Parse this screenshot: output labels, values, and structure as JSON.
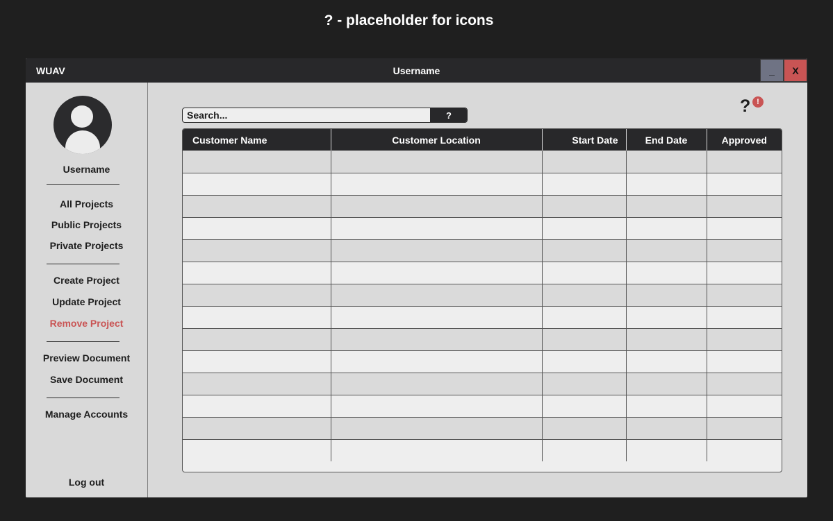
{
  "note": "? - placeholder for icons",
  "window": {
    "app_name": "WUAV",
    "title": "Username",
    "minimize_label": "_",
    "close_label": "X"
  },
  "sidebar": {
    "username": "Username",
    "nav": {
      "all_projects": "All Projects",
      "public_projects": "Public Projects",
      "private_projects": "Private Projects",
      "create_project": "Create Project",
      "update_project": "Update Project",
      "remove_project": "Remove Project",
      "preview_document": "Preview Document",
      "save_document": "Save Document",
      "manage_accounts": "Manage Accounts",
      "log_out": "Log out"
    }
  },
  "search": {
    "placeholder": "Search...",
    "button_label": "?"
  },
  "notifications": {
    "help_icon_label": "?",
    "alert_badge_label": "!"
  },
  "table": {
    "columns": [
      "Customer Name",
      "Customer Location",
      "Start Date",
      "End Date",
      "Approved"
    ],
    "rows": [
      [
        "",
        "",
        "",
        "",
        ""
      ],
      [
        "",
        "",
        "",
        "",
        ""
      ],
      [
        "",
        "",
        "",
        "",
        ""
      ],
      [
        "",
        "",
        "",
        "",
        ""
      ],
      [
        "",
        "",
        "",
        "",
        ""
      ],
      [
        "",
        "",
        "",
        "",
        ""
      ],
      [
        "",
        "",
        "",
        "",
        ""
      ],
      [
        "",
        "",
        "",
        "",
        ""
      ],
      [
        "",
        "",
        "",
        "",
        ""
      ],
      [
        "",
        "",
        "",
        "",
        ""
      ],
      [
        "",
        "",
        "",
        "",
        ""
      ],
      [
        "",
        "",
        "",
        "",
        ""
      ],
      [
        "",
        "",
        "",
        "",
        ""
      ],
      [
        "",
        "",
        "",
        "",
        ""
      ]
    ]
  },
  "colors": {
    "background": "#1f1f1f",
    "titlebar": "#28282a",
    "panel": "#d9d9d9",
    "row_alt": "#eeeeee",
    "accent_danger": "#c95454",
    "minimize_button": "#6f7384"
  }
}
